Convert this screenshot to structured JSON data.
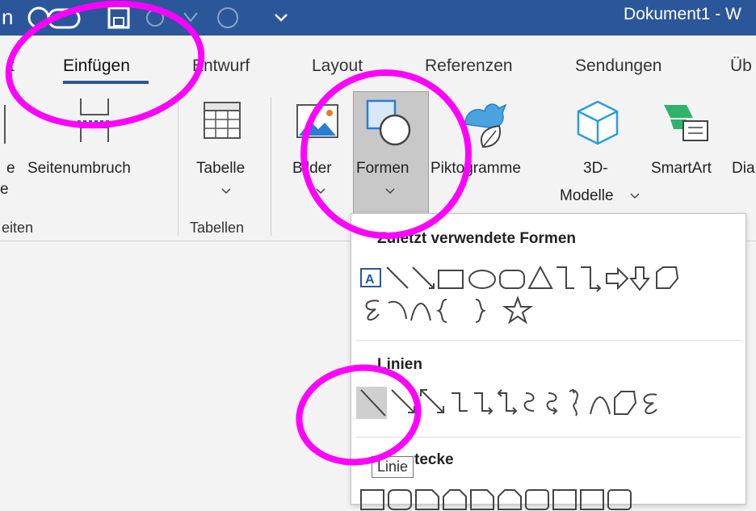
{
  "window": {
    "title_fragment": "Dokument1  -  W",
    "left_fragment": "n"
  },
  "tabs": [
    {
      "label": "t"
    },
    {
      "label": "Einfügen"
    },
    {
      "label": "Entwurf"
    },
    {
      "label": "Layout"
    },
    {
      "label": "Referenzen"
    },
    {
      "label": "Sendungen"
    },
    {
      "label": "Üb"
    }
  ],
  "ribbon": {
    "left_cut": {
      "line1": "e",
      "line2": "e"
    },
    "seitenumbruch": "Seitenumbruch",
    "tabelle": "Tabelle",
    "bilder": "Bilder",
    "formen": "Formen",
    "piktogramme": "Piktogramme",
    "modelle_line1": "3D-",
    "modelle_line2": "Modelle",
    "smartart": "SmartArt",
    "diagramm_cut": "Dia",
    "groups": {
      "seiten": "eiten",
      "tabellen": "Tabellen"
    }
  },
  "shapes_panel": {
    "recent_heading": "Zuletzt verwendete Formen",
    "lines_heading": "Linien",
    "rect_heading": "Rechtecke",
    "rect_visible": "tecke"
  },
  "tooltip": "Linie",
  "colors": {
    "titlebar": "#2b579a",
    "annotation": "#ff00ff",
    "accent": "#2b579a"
  }
}
